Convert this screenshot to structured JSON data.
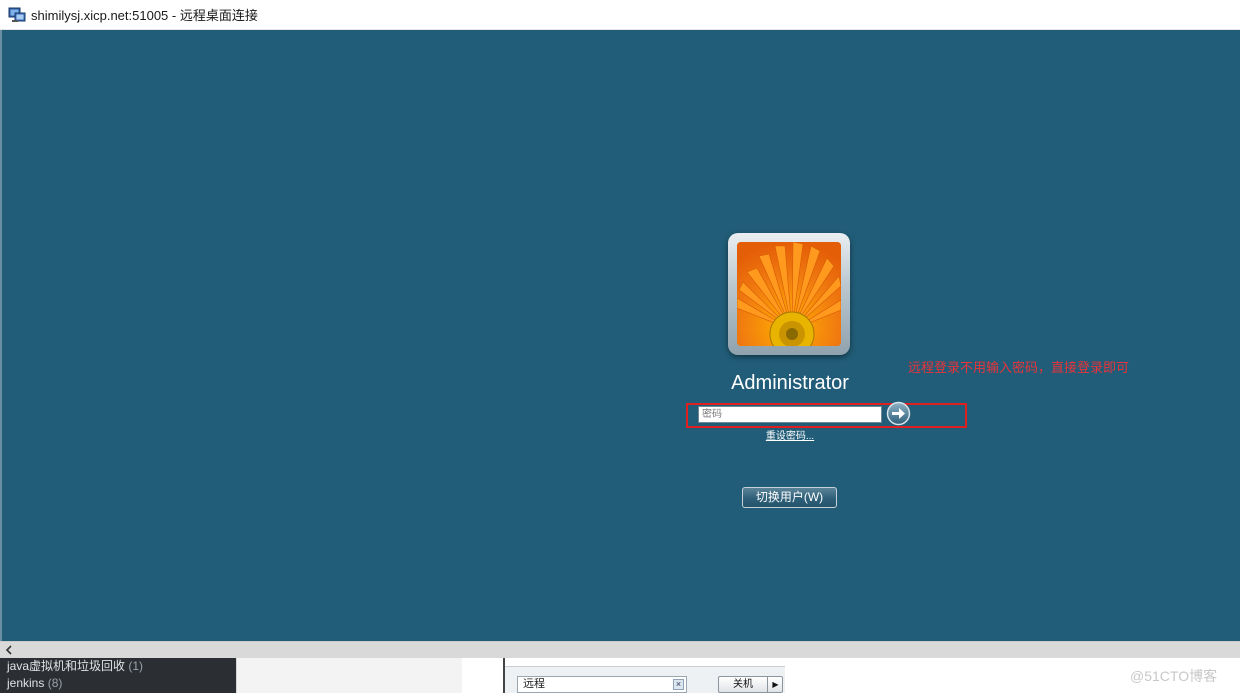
{
  "window": {
    "title": "shimilysj.xicp.net:51005 - 远程桌面连接"
  },
  "login": {
    "username": "Administrator",
    "password_placeholder": "密码",
    "reset_link": "重设密码...",
    "switch_user_button": "切换用户(W)"
  },
  "annotation": {
    "text": "远程登录不用输入密码，直接登录即可",
    "color": "#e8343a"
  },
  "colors": {
    "desktop_background": "#215d78",
    "highlight_border": "#e02020"
  },
  "icons": {
    "app": "remote-desktop-icon",
    "submit": "arrow-right-icon",
    "scroll_left": "chevron-left-icon"
  },
  "taskbar": {
    "sidebar_items": [
      {
        "label": "java虚拟机和垃圾回收",
        "count": "(1)"
      },
      {
        "label": "jenkins",
        "count": "(8)"
      }
    ],
    "search_value": "远程",
    "shutdown_label": "关机",
    "watermark": "@51CTO博客"
  }
}
